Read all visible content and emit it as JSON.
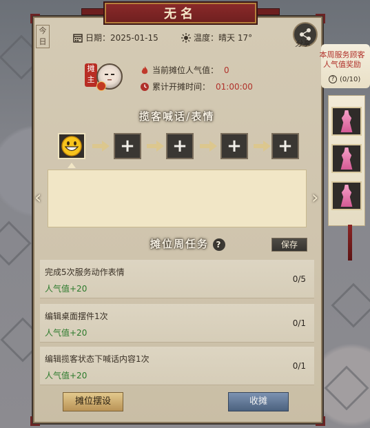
{
  "window": {
    "title": "无名",
    "today_label": "今日"
  },
  "header": {
    "date_label": "日期：",
    "date_value": "2025-01-15",
    "temp_label": "温度：",
    "temp_value": "晴天 17°",
    "share_label": "分享"
  },
  "owner": {
    "seal_label": "摊主",
    "popularity_label": "当前摊位人气值：",
    "popularity_value": "0",
    "open_time_label": "累计开摊时间：",
    "open_time_value": "01:00:00"
  },
  "shout": {
    "title": "揽客喊话/表情",
    "slots": [
      {
        "type": "emote",
        "icon": "grinning-face-icon"
      },
      {
        "type": "empty",
        "symbol": "+"
      },
      {
        "type": "empty",
        "symbol": "+"
      },
      {
        "type": "empty",
        "symbol": "+"
      },
      {
        "type": "empty",
        "symbol": "+"
      }
    ],
    "text_value": ""
  },
  "weekly_tasks": {
    "title": "摊位周任务",
    "help_symbol": "?",
    "save_label": "保存",
    "items": [
      {
        "name": "完成5次服务动作表情",
        "reward": "人气值+20",
        "progress": "0/5"
      },
      {
        "name": "编辑桌面摆件1次",
        "reward": "人气值+20",
        "progress": "0/1"
      },
      {
        "name": "编辑揽客状态下喊话内容1次",
        "reward": "人气值+20",
        "progress": "0/1"
      }
    ]
  },
  "footer": {
    "layout_button": "摊位摆设",
    "close_button": "收摊"
  },
  "reward_scroll": {
    "line1": "本周服务顾客",
    "line2": "人气值奖励",
    "help_symbol": "?",
    "count": "(0/10)"
  },
  "action_slots": [
    {
      "icon": "bow-pose-icon"
    },
    {
      "icon": "greet-pose-icon"
    },
    {
      "icon": "kneel-pose-icon"
    }
  ],
  "colors": {
    "accent_red": "#b0312a",
    "reward_green": "#2b7a2b",
    "title_bar": "#6d1f1f"
  }
}
